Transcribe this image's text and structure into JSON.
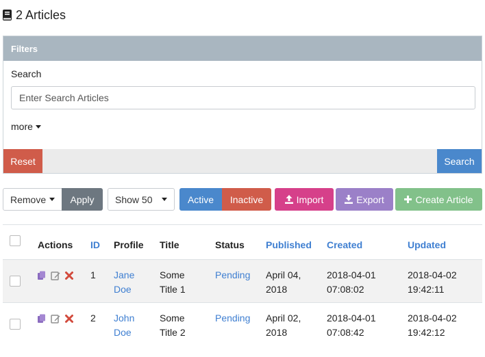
{
  "header": {
    "title": "2 Articles"
  },
  "filters": {
    "heading": "Filters",
    "search_label": "Search",
    "search_placeholder": "Enter Search Articles",
    "more_label": "more",
    "reset_label": "Reset",
    "search_button_label": "Search"
  },
  "toolbar": {
    "bulk_action_selected": "Remove",
    "apply_label": "Apply",
    "page_size_selected": "Show 50",
    "active_label": "Active",
    "inactive_label": "Inactive",
    "import_label": "Import",
    "export_label": "Export",
    "create_label": "Create Article"
  },
  "table": {
    "columns": {
      "actions": "Actions",
      "id": "ID",
      "profile": "Profile",
      "title": "Title",
      "status": "Status",
      "published": "Published",
      "created": "Created",
      "updated": "Updated"
    },
    "rows": [
      {
        "id": "1",
        "profile": [
          "Jane",
          "Doe"
        ],
        "title": [
          "Some",
          "Title 1"
        ],
        "status": "Pending",
        "published": [
          "April 04,",
          "2018"
        ],
        "created": [
          "2018-04-01",
          "07:08:02"
        ],
        "updated": [
          "2018-04-02",
          "19:42:11"
        ]
      },
      {
        "id": "2",
        "profile": [
          "John",
          "Doe"
        ],
        "title": [
          "Some",
          "Title 2"
        ],
        "status": "Pending",
        "published": [
          "April 02,",
          "2018"
        ],
        "created": [
          "2018-04-01",
          "07:08:42"
        ],
        "updated": [
          "2018-04-02",
          "19:42:12"
        ]
      }
    ]
  },
  "colors": {
    "filters_header": "#a9b6c0",
    "reset": "#d05c4a",
    "search": "#4a88cc",
    "apply": "#6d7780",
    "active": "#4a88cc",
    "inactive": "#d05c4a",
    "import": "#d6408a",
    "export": "#9b80c8",
    "create": "#82c18a",
    "link": "#3f7fd1"
  },
  "icons": {
    "title": "book-icon",
    "import": "upload-icon",
    "export": "download-icon",
    "create": "plus-icon",
    "row_actions": [
      "copy-icon",
      "edit-icon",
      "delete-icon"
    ]
  }
}
